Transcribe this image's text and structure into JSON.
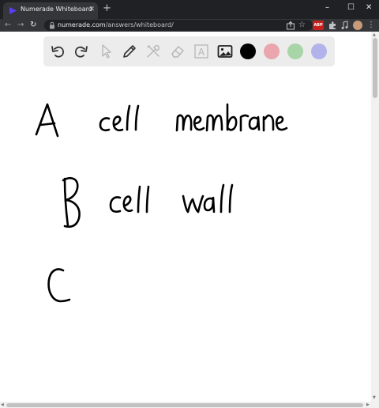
{
  "browser": {
    "tab_title": "Numerade Whiteboard",
    "tab_close": "✕",
    "new_tab": "+",
    "url_host": "numerade.com",
    "url_path": "/answers/whiteboard/",
    "window_controls": {
      "minimize": "–",
      "maximize": "☐",
      "close": "✕"
    },
    "nav": {
      "back": "←",
      "forward": "→",
      "reload": "↻"
    },
    "extension_badge": "ABP",
    "colors": {
      "tab_strip": "#202124",
      "active_tab": "#35363a",
      "omnibox": "#202124",
      "brand": "#5b3df5"
    }
  },
  "whiteboard": {
    "tools": [
      {
        "name": "undo-icon"
      },
      {
        "name": "redo-icon"
      },
      {
        "name": "pointer-icon"
      },
      {
        "name": "pen-icon"
      },
      {
        "name": "tools-icon"
      },
      {
        "name": "eraser-icon"
      },
      {
        "name": "text-icon",
        "label": "A"
      },
      {
        "name": "image-icon"
      }
    ],
    "colors": [
      {
        "name": "black",
        "hex": "#000000"
      },
      {
        "name": "pink",
        "hex": "#eaa5ad"
      },
      {
        "name": "green",
        "hex": "#a8d5a8"
      },
      {
        "name": "lavender",
        "hex": "#b3b3eb"
      }
    ],
    "handwriting": [
      "A   cell membrane",
      "B   cell wall",
      "C"
    ]
  }
}
